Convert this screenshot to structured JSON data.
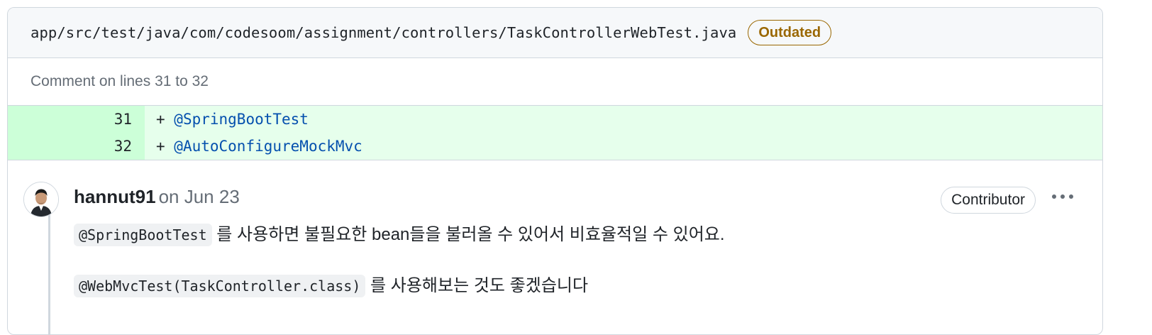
{
  "file": {
    "path": "app/src/test/java/com/codesoom/assignment/controllers/TaskControllerWebTest.java",
    "badge": "Outdated"
  },
  "comment_range": "Comment on lines 31 to 32",
  "diff": {
    "lines": [
      {
        "number": "31",
        "marker": "+ ",
        "code": "@SpringBootTest"
      },
      {
        "number": "32",
        "marker": "+ ",
        "code": "@AutoConfigureMockMvc"
      }
    ]
  },
  "comment": {
    "author": "hannut91",
    "date": "on Jun 23",
    "role_badge": "Contributor",
    "paragraph1_code": "@SpringBootTest",
    "paragraph1_text": " 를 사용하면 불필요한 bean들을 불러올 수 있어서 비효율적일 수 있어요.",
    "paragraph2_code": "@WebMvcTest(TaskController.class)",
    "paragraph2_text": " 를 사용해보는 것도 좋겠습니다"
  },
  "colors": {
    "outdated": "#9a6700",
    "diff_add_num_bg": "#ccffd8",
    "diff_add_code_bg": "#e6ffec",
    "annotation": "#0550ae"
  },
  "icons": {
    "avatar": "avatar-icon",
    "more": "kebab-horizontal-icon"
  }
}
